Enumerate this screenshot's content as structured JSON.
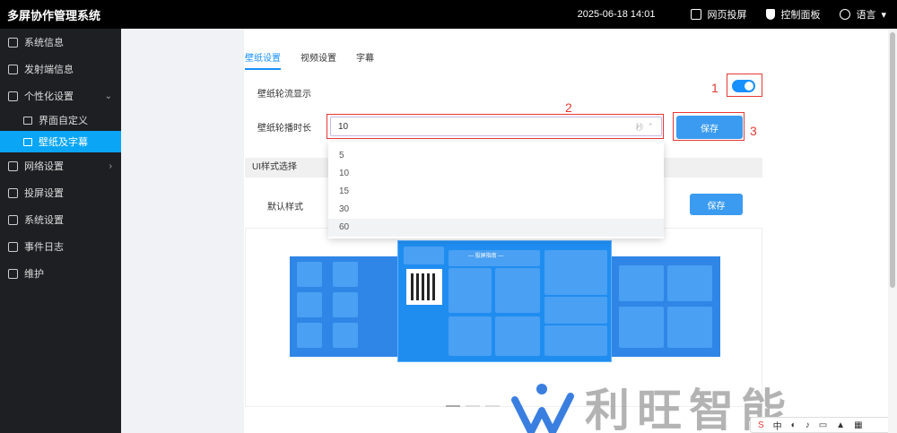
{
  "app": {
    "title": "多屏协作管理系统"
  },
  "topbar": {
    "datetime": "2025-06-18 14:01",
    "web_projection": "网页投屏",
    "control_panel": "控制面板",
    "language": "语言"
  },
  "sidebar": {
    "items": [
      {
        "label": "系统信息"
      },
      {
        "label": "发射端信息"
      },
      {
        "label": "个性化设置"
      },
      {
        "label": "界面自定义"
      },
      {
        "label": "壁纸及字幕"
      },
      {
        "label": "网络设置"
      },
      {
        "label": "投屏设置"
      },
      {
        "label": "系统设置"
      },
      {
        "label": "事件日志"
      },
      {
        "label": "维护"
      }
    ]
  },
  "tabs": [
    {
      "label": "壁纸设置",
      "active": true
    },
    {
      "label": "视频设置",
      "active": false
    },
    {
      "label": "字幕",
      "active": false
    }
  ],
  "wallpaper": {
    "carousel_label": "壁纸轮流显示",
    "carousel_enabled": true,
    "duration_label": "壁纸轮播时长",
    "duration_value": "10",
    "duration_unit": "秒",
    "save_label": "保存",
    "options": [
      "5",
      "10",
      "15",
      "30",
      "60"
    ],
    "hovered_option": "60"
  },
  "annotations": {
    "one": "1",
    "two": "2",
    "three": "3"
  },
  "ui_style": {
    "section_title": "UI样式选择",
    "style_label": "默认样式",
    "save_label": "保存",
    "preview_title": "— 投屏指南 —"
  },
  "watermark": {
    "text": "利旺智能"
  },
  "ime": {
    "mode": "中"
  },
  "colors": {
    "accent": "#1890ff",
    "sidebar_active": "#0aa6f5",
    "annotation_red": "#e53935"
  }
}
